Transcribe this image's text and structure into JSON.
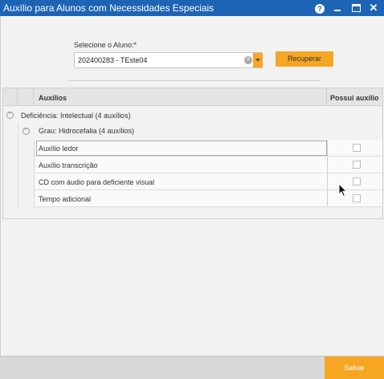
{
  "window": {
    "title": "Auxílio para Alunos com Necessidades Especiais",
    "help_icon": "?",
    "close_icon": "✕"
  },
  "form": {
    "student_label": "Selecione o Aluno:*",
    "student_value": "202400283 - TEste04",
    "retrieve_button": "Recuperar"
  },
  "grid": {
    "columns": [
      "Auxílios",
      "Possui auxílio"
    ],
    "group1": "Deficiência: Intelectual (4 auxílios)",
    "group2": "Grau: Hidrocefalia (4 auxílios)",
    "rows": [
      {
        "label": "Auxílio ledor",
        "checked": false
      },
      {
        "label": "Auxílio transcrição",
        "checked": false
      },
      {
        "label": "CD com áudio para deficiente visual",
        "checked": false
      },
      {
        "label": "Tempo adicional",
        "checked": false
      }
    ]
  },
  "footer": {
    "save_button": "Salvar"
  },
  "colors": {
    "titlebar": "#1e64b4",
    "accent": "#f6a623"
  }
}
